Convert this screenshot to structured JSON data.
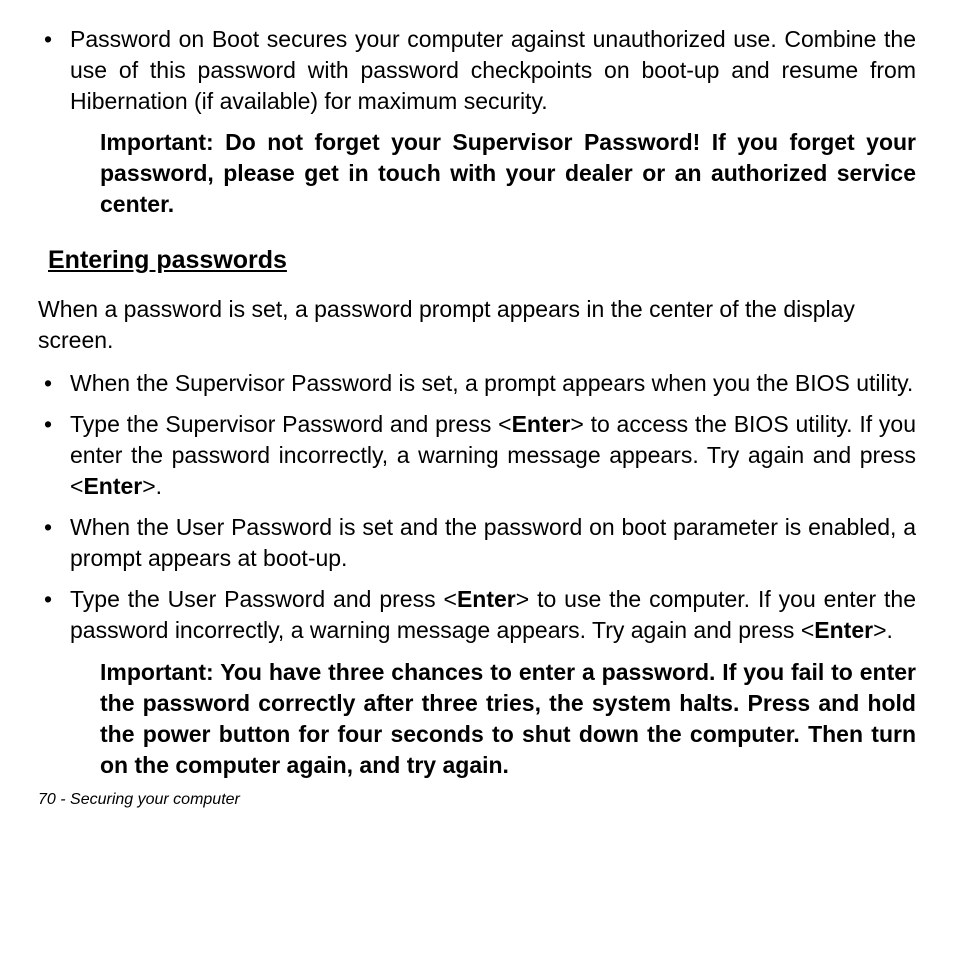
{
  "top_bullet": "Password on Boot secures your computer against unauthorized use. Combine the use of this password with password checkpoints on boot-up and resume from Hibernation (if available) for maximum security.",
  "top_note": "Important: Do not forget your Supervisor Password! If you forget your password, please get in touch with your dealer or an authorized service center.",
  "section_heading": "Entering passwords",
  "intro_paragraph": "When a password is set, a password prompt appears in the center of the display screen.",
  "bullets": {
    "b1": "When the Supervisor Password is set, a prompt appears when you the BIOS utility.",
    "b2": {
      "p1": "Type the Supervisor Password and press <",
      "k1": "Enter",
      "p2": "> to access the BIOS utility. If you enter the password incorrectly, a warning message appears. Try again and press <",
      "k2": "Enter",
      "p3": ">."
    },
    "b3": "When the User Password is set and the password on boot parameter is enabled, a prompt appears at boot-up.",
    "b4": {
      "p1": "Type the User Password and press <",
      "k1": "Enter",
      "p2": "> to use the computer. If you enter the password incorrectly, a warning message appears. Try again and press <",
      "k2": "Enter",
      "p3": ">."
    }
  },
  "bottom_note": "Important: You have three chances to enter a password. If you fail to enter the password correctly after three tries, the system halts. Press and hold the power button for four seconds to shut down the computer. Then turn on the computer again, and try again.",
  "footer": "70 - Securing your computer"
}
